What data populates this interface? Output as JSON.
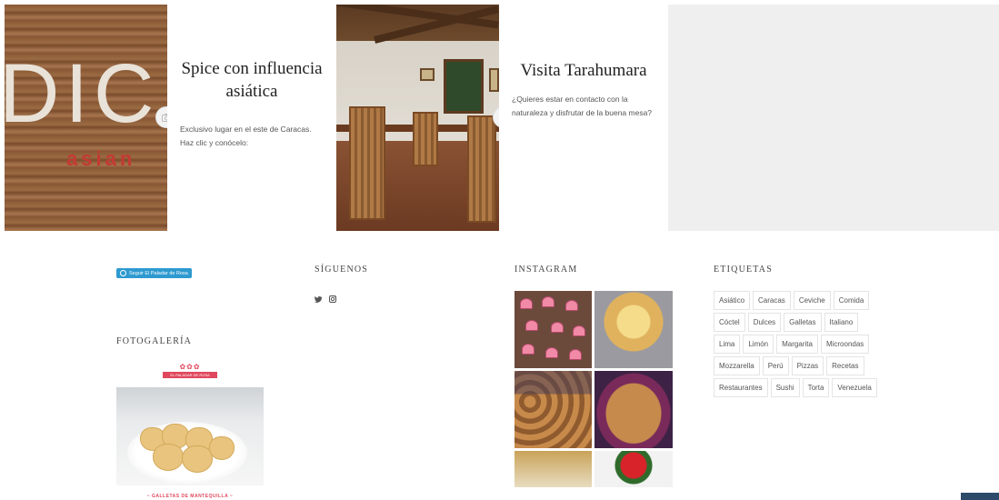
{
  "promo": {
    "spice": {
      "image_sign_text": "DIC",
      "image_subtext": "asian",
      "title": "Spice con influencia asiática",
      "description": "Exclusivo lugar en el este de Caracas. Haz clic y conócelo:"
    },
    "tarahumara": {
      "title": "Visita Tarahumara",
      "description": "¿Quieres estar en contacto con la naturaleza y disfrutar de la buena mesa?"
    }
  },
  "footer": {
    "follow_button": "Seguir El Paladar de Rosa",
    "photo_gallery_title": "FOTOGALERÍA",
    "gallery_logo_text": "EL PALADAR DE ROSA",
    "gallery_caption": "~ GALLETAS DE MANTEQUILLA ~",
    "social_title": "SÍGUENOS",
    "social_icons": [
      "twitter-icon",
      "instagram-icon"
    ],
    "instagram_title": "INSTAGRAM",
    "tags_title": "ETIQUETAS",
    "tags": [
      "Asiático",
      "Caracas",
      "Ceviche",
      "Comida",
      "Cóctel",
      "Dulces",
      "Galletas",
      "Italiano",
      "Lima",
      "Limón",
      "Margarita",
      "Microondas",
      "Mozzarella",
      "Perú",
      "Pizzas",
      "Recetas",
      "Restaurantes",
      "Sushi",
      "Torta",
      "Venezuela"
    ]
  },
  "colors": {
    "follow_button": "#2e9ad0",
    "gallery_accent": "#e0475d",
    "gray_panel": "#efefef"
  }
}
